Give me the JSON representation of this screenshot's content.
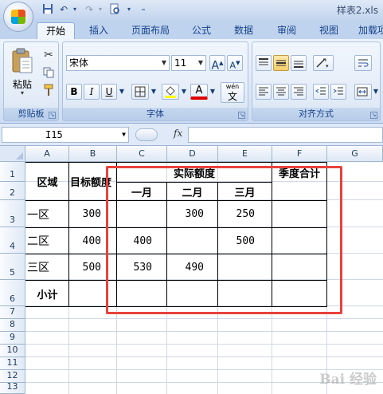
{
  "window": {
    "title": "样表2.xls"
  },
  "quick_access": {
    "save_icon": "save-icon",
    "undo_icon": "undo-icon",
    "redo_icon": "redo-icon",
    "print_preview_icon": "print-preview-icon",
    "customize_icon": "customize-icon"
  },
  "ribbon_tabs": [
    {
      "label": "开始",
      "active": true
    },
    {
      "label": "插入"
    },
    {
      "label": "页面布局"
    },
    {
      "label": "公式"
    },
    {
      "label": "数据"
    },
    {
      "label": "审阅"
    },
    {
      "label": "视图"
    },
    {
      "label": "加载项"
    }
  ],
  "groups": {
    "clipboard": {
      "label": "剪贴板",
      "paste_label": "粘贴"
    },
    "font": {
      "label": "字体",
      "font_name": "宋体",
      "font_size": "11",
      "bold": "B",
      "italic": "I",
      "underline": "U",
      "wen": "wén",
      "wen_char": "文",
      "grow": "A",
      "shrink": "A"
    },
    "alignment": {
      "label": "对齐方式"
    }
  },
  "formula_bar": {
    "name_box": "I15",
    "fx_label": "fx",
    "formula": ""
  },
  "sheet": {
    "columns": [
      "A",
      "B",
      "C",
      "D",
      "E",
      "F",
      "G"
    ],
    "rows": [
      "1",
      "2",
      "3",
      "4",
      "5",
      "6",
      "7",
      "8",
      "9",
      "10",
      "11",
      "12",
      "13"
    ],
    "cells": {
      "a1": "区域",
      "b1": "目标额度",
      "c1": "实际额度",
      "f1": "季度合计",
      "c2": "一月",
      "d2": "二月",
      "e2": "三月",
      "a3": "一区",
      "b3": "300",
      "d3": "300",
      "e3": "250",
      "a4": "二区",
      "b4": "400",
      "c4": "400",
      "e4": "500",
      "a5": "三区",
      "b5": "500",
      "c5": "530",
      "d5": "490",
      "a6": "小计"
    }
  },
  "watermark": "Bai 经验",
  "colors": {
    "highlight": "#e8413c",
    "ribbon_text": "#15428b"
  }
}
